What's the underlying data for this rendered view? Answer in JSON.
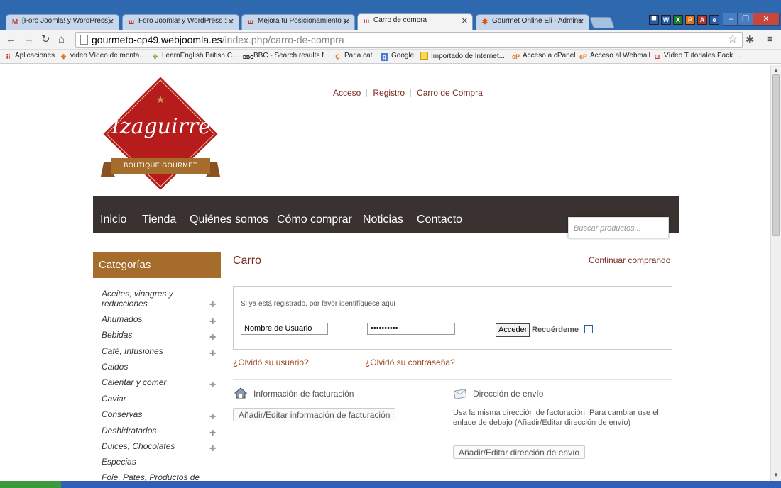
{
  "browser": {
    "tabs": [
      {
        "label": "[Foro Joomla! y WordPress]",
        "icon": "gmail-icon",
        "active": false
      },
      {
        "label": "Foro Joomla! y WordPress ::",
        "icon": "webjoomla-icon",
        "active": false
      },
      {
        "label": "Mejora tu Posicionamiento y",
        "icon": "webjoomla-icon",
        "active": false
      },
      {
        "label": "Carro de compra",
        "icon": "webjoomla-icon",
        "active": true
      },
      {
        "label": "Gourmet Online Eli - Administ",
        "icon": "joomla-icon",
        "active": false
      }
    ],
    "address": {
      "host": "gourmeto-cp49.webjoomla.es",
      "path": "/index.php/carro-de-compra"
    },
    "bookmarks": [
      {
        "label": "Aplicaciones",
        "icon": "apps-icon"
      },
      {
        "label": "video Vídeo de monta...",
        "icon": "video-icon"
      },
      {
        "label": "LearnEnglish British C...",
        "icon": "british-council-icon"
      },
      {
        "label": "BBC - Search results f...",
        "icon": "bbc-icon"
      },
      {
        "label": "Parla.cat",
        "icon": "parla-icon"
      },
      {
        "label": "Google",
        "icon": "google-icon"
      },
      {
        "label": "Importado de Internet...",
        "icon": "folder-icon"
      },
      {
        "label": "Acceso a cPanel",
        "icon": "cpanel-icon"
      },
      {
        "label": "Acceso al Webmail",
        "icon": "cpanel-icon"
      },
      {
        "label": "Vídeo Tutoriales Pack ...",
        "icon": "webjoomla-icon"
      }
    ]
  },
  "site": {
    "logo": {
      "name": "Izaguirre",
      "ribbon": "BOUTIQUE GOURMET",
      "color": "#b71c1c",
      "ribbon_color": "#a56c2c"
    },
    "top_links": [
      "Acceso",
      "Registro",
      "Carro de Compra"
    ],
    "main_nav": [
      "Inicio",
      "Tienda",
      "Quiénes somos",
      "Cómo comprar",
      "Noticias",
      "Contacto"
    ],
    "search_placeholder": "Buscar productos...",
    "categories_title": "Categorías",
    "categories": [
      {
        "label": "Aceites, vinagres y reducciones",
        "expandable": true
      },
      {
        "label": "Ahumados",
        "expandable": true
      },
      {
        "label": "Bebidas",
        "expandable": true
      },
      {
        "label": "Café, Infusiones",
        "expandable": true
      },
      {
        "label": "Caldos",
        "expandable": false
      },
      {
        "label": "Calentar y comer",
        "expandable": true
      },
      {
        "label": "Caviar",
        "expandable": false
      },
      {
        "label": "Conservas",
        "expandable": true
      },
      {
        "label": "Deshidratados",
        "expandable": true
      },
      {
        "label": "Dulces, Chocolates",
        "expandable": true
      },
      {
        "label": "Especias",
        "expandable": false
      },
      {
        "label": "Foie, Pates, Productos de",
        "expandable": false
      }
    ],
    "colors": {
      "accent": "#7a2a22",
      "nav_bg": "#3a3131",
      "category_header": "#a56c2c"
    }
  },
  "cart": {
    "title": "Carro",
    "continue_link": "Continuar comprando",
    "login_prompt": "Si ya está registrado, por favor identifíquese aquí",
    "username_value": "Nombre de Usuario",
    "password_value": "••••••••••",
    "login_button": "Acceder",
    "remember_label": "Recuérdeme",
    "forgot_user": "¿Olvidó su usuario?",
    "forgot_password": "¿Olvidó su contraseña?",
    "billing_title": "Información de facturación",
    "billing_button": "Añadir/Editar información de facturación",
    "shipping_title": "Dirección de envío",
    "shipping_text": "Usa la misma dirección de facturación. Para cambiar use el enlace de debajo (Añadir/Editar dirección de envío)",
    "shipping_button": "Añadir/Editar dirección de envío"
  }
}
